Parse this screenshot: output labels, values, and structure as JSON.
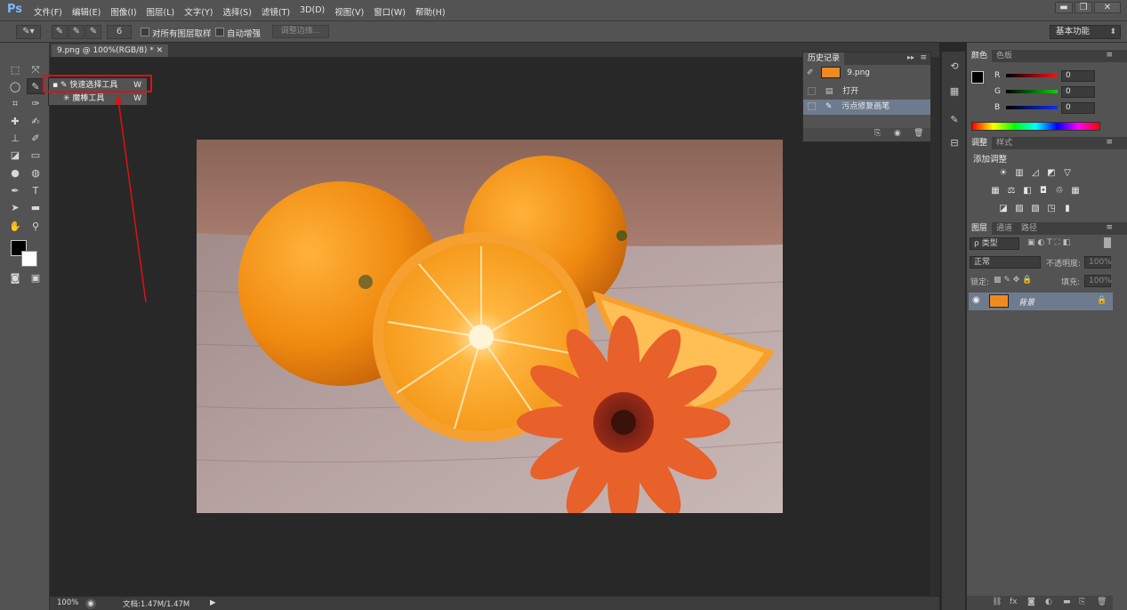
{
  "app": {
    "logo": "Ps",
    "menu": [
      "文件(F)",
      "编辑(E)",
      "图像(I)",
      "图层(L)",
      "文字(Y)",
      "选择(S)",
      "滤镜(T)",
      "3D(D)",
      "视图(V)",
      "窗口(W)",
      "帮助(H)"
    ],
    "window_buttons": {
      "minimize": "▬",
      "restore": "❐",
      "close": "✕"
    }
  },
  "options_bar": {
    "brush_size": "6",
    "sample_all_layers": "对所有图层取样",
    "auto_enhance": "自动增强",
    "refine_edge": "调整边缘...",
    "workspace": "基本功能"
  },
  "document": {
    "tab_title": "9.png @ 100%(RGB/8) *",
    "zoom": "100%",
    "doc_info": "文档:1.47M/1.47M"
  },
  "tool_flyout": {
    "items": [
      {
        "label": "快速选择工具",
        "key": "W",
        "active": true
      },
      {
        "label": "魔棒工具",
        "key": "W",
        "active": false
      }
    ]
  },
  "history_panel": {
    "tab": "历史记录",
    "snapshot": "9.png",
    "steps": [
      {
        "label": "打开",
        "selected": false
      },
      {
        "label": "污点修复画笔",
        "selected": true
      }
    ]
  },
  "color_panel": {
    "tabs": [
      "颜色",
      "色板"
    ],
    "channels": [
      {
        "label": "R",
        "value": "0",
        "color": "#ff2020"
      },
      {
        "label": "G",
        "value": "0",
        "color": "#20c020"
      },
      {
        "label": "B",
        "value": "0",
        "color": "#2040ff"
      }
    ]
  },
  "adjustments_panel": {
    "tabs": [
      "调整",
      "样式"
    ],
    "title": "添加调整"
  },
  "layers_panel": {
    "tabs": [
      "图层",
      "通道",
      "路径"
    ],
    "filter": "ρ 类型",
    "blend_mode": "正常",
    "opacity_label": "不透明度:",
    "opacity_value": "100%",
    "lock_label": "锁定:",
    "fill_label": "填充:",
    "fill_value": "100%",
    "layer_name": "背景"
  }
}
